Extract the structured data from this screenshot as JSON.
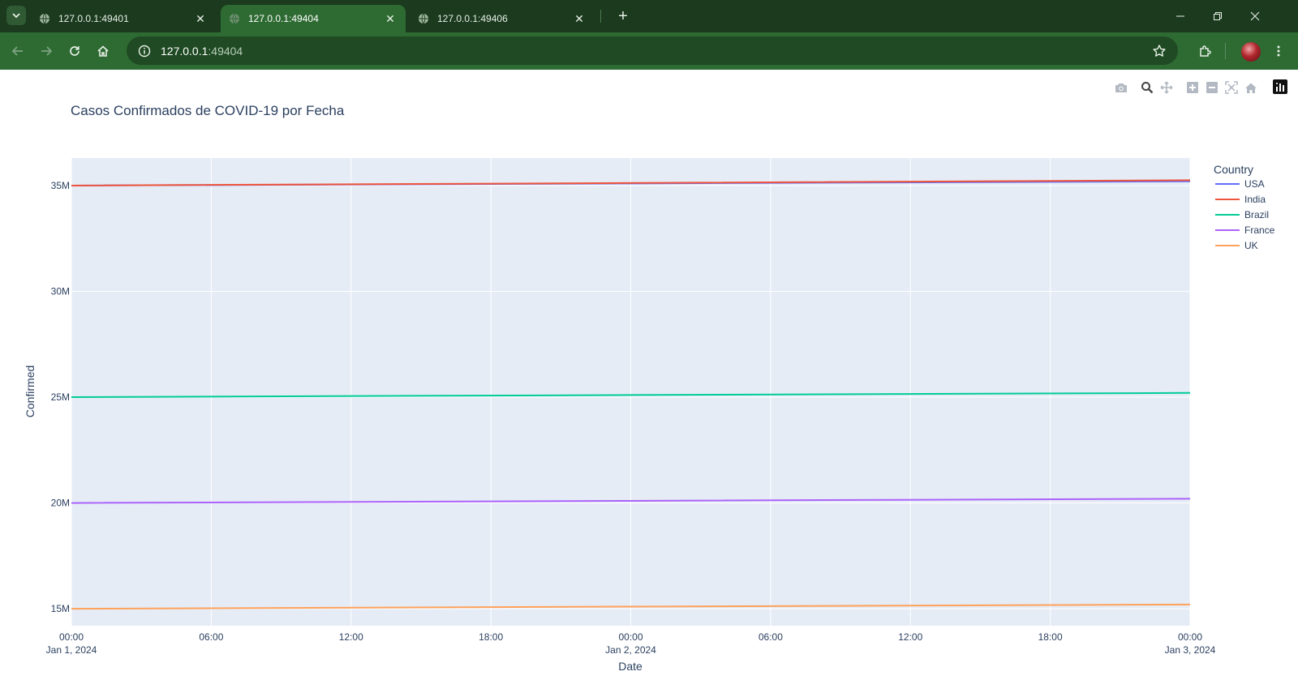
{
  "browser": {
    "tabs": [
      {
        "title": "127.0.0.1:49401",
        "active": false
      },
      {
        "title": "127.0.0.1:49404",
        "active": true
      },
      {
        "title": "127.0.0.1:49406",
        "active": false
      }
    ],
    "address": {
      "host": "127.0.0.1",
      "port": ":49404"
    },
    "colors": {
      "frame": "#1b3a1e",
      "toolbar": "#2e6b33",
      "omnibox": "#1f4a23"
    }
  },
  "modebar": {
    "icons": [
      "camera-icon",
      "zoom-icon",
      "pan-icon",
      "zoom-in-icon",
      "zoom-out-icon",
      "autoscale-icon",
      "reset-axes-icon",
      "plotly-logo-icon"
    ]
  },
  "chart_data": {
    "type": "line",
    "title": "Casos Confirmados de COVID-19 por Fecha",
    "xlabel": "Date",
    "ylabel": "Confirmed",
    "legend_title": "Country",
    "legend_position": "top-right",
    "grid": true,
    "plot_background": "#e5ecf6",
    "xlim": [
      "2024-01-01 00:00",
      "2024-01-03 00:00"
    ],
    "ylim": [
      14.2,
      36.3
    ],
    "y_unit": "M",
    "x": [
      "2024-01-01",
      "2024-01-02",
      "2024-01-03"
    ],
    "x_ticks": [
      {
        "value": "2024-01-01 00:00",
        "label": "00:00",
        "sublabel": "Jan 1, 2024"
      },
      {
        "value": "2024-01-01 06:00",
        "label": "06:00",
        "sublabel": ""
      },
      {
        "value": "2024-01-01 12:00",
        "label": "12:00",
        "sublabel": ""
      },
      {
        "value": "2024-01-01 18:00",
        "label": "18:00",
        "sublabel": ""
      },
      {
        "value": "2024-01-02 00:00",
        "label": "00:00",
        "sublabel": "Jan 2, 2024"
      },
      {
        "value": "2024-01-02 06:00",
        "label": "06:00",
        "sublabel": ""
      },
      {
        "value": "2024-01-02 12:00",
        "label": "12:00",
        "sublabel": ""
      },
      {
        "value": "2024-01-02 18:00",
        "label": "18:00",
        "sublabel": ""
      },
      {
        "value": "2024-01-03 00:00",
        "label": "00:00",
        "sublabel": "Jan 3, 2024"
      }
    ],
    "y_ticks": [
      {
        "value": 15,
        "label": "15M"
      },
      {
        "value": 20,
        "label": "20M"
      },
      {
        "value": 25,
        "label": "25M"
      },
      {
        "value": 30,
        "label": "30M"
      },
      {
        "value": 35,
        "label": "35M"
      }
    ],
    "series": [
      {
        "name": "USA",
        "color": "#636efa",
        "values": [
          35.0,
          35.1,
          35.2
        ]
      },
      {
        "name": "India",
        "color": "#ef553b",
        "values": [
          35.0,
          35.12,
          35.25
        ]
      },
      {
        "name": "Brazil",
        "color": "#00cc96",
        "values": [
          25.0,
          25.1,
          25.2
        ]
      },
      {
        "name": "France",
        "color": "#ab63fa",
        "values": [
          20.0,
          20.1,
          20.2
        ]
      },
      {
        "name": "UK",
        "color": "#ffa15a",
        "values": [
          15.0,
          15.1,
          15.2
        ]
      }
    ]
  }
}
